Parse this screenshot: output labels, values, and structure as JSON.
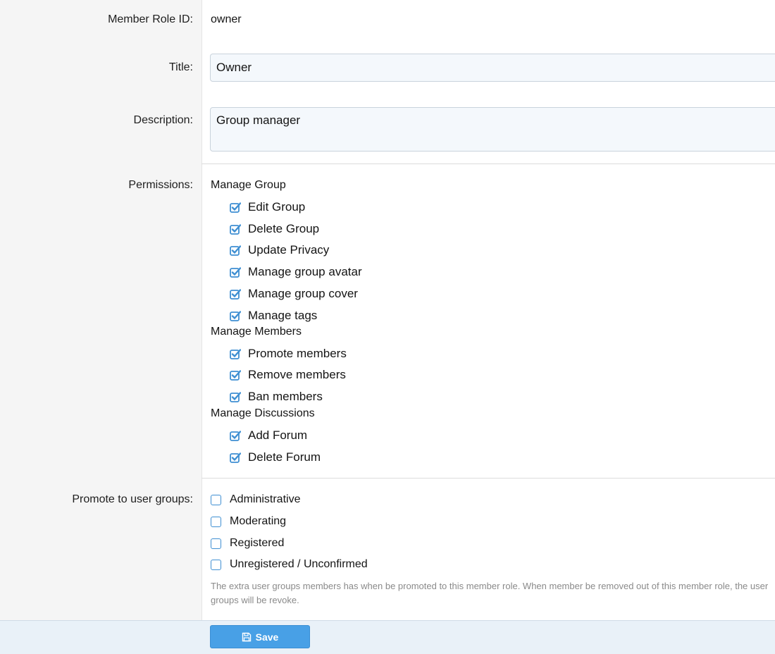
{
  "form": {
    "member_role_id": {
      "label": "Member Role ID:",
      "value": "owner"
    },
    "title": {
      "label": "Title:",
      "value": "Owner"
    },
    "description": {
      "label": "Description:",
      "value": "Group manager"
    },
    "permissions": {
      "label": "Permissions:",
      "groups": [
        {
          "name": "Manage Group",
          "items": [
            "Edit Group",
            "Delete Group",
            "Update Privacy",
            "Manage group avatar",
            "Manage group cover",
            "Manage tags"
          ]
        },
        {
          "name": "Manage Members",
          "items": [
            "Promote members",
            "Remove members",
            "Ban members"
          ]
        },
        {
          "name": "Manage Discussions",
          "items": [
            "Add Forum",
            "Delete Forum"
          ]
        }
      ]
    },
    "user_groups": {
      "label": "Promote to user groups:",
      "options": [
        "Administrative",
        "Moderating",
        "Registered",
        "Unregistered / Unconfirmed"
      ],
      "hint": "The extra user groups members has when be promoted to this member role. When member be removed out of this member role, the user groups will be revoke."
    }
  },
  "footer": {
    "save_label": "Save"
  },
  "colors": {
    "accent": "#48a0e6",
    "checkbox": "#3f8fd2"
  }
}
